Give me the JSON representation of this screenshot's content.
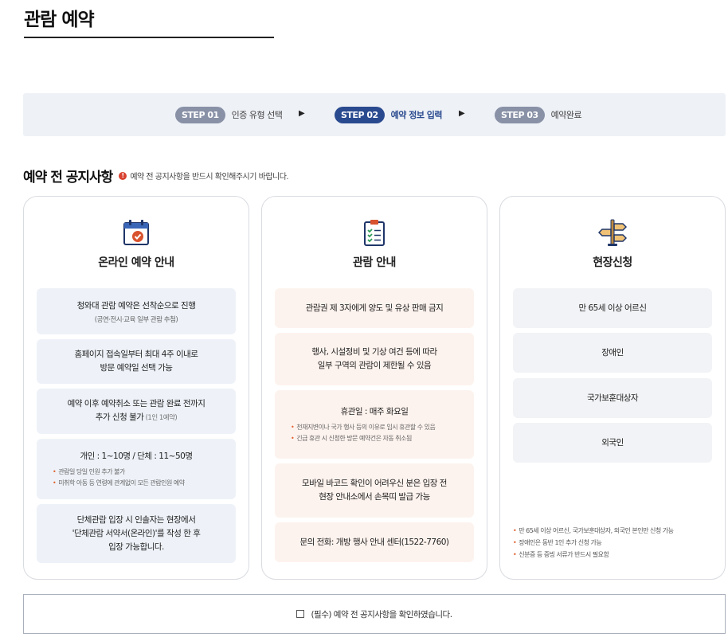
{
  "page": {
    "title": "관람 예약"
  },
  "steps": [
    {
      "badge": "STEP 01",
      "label": "인증 유형 선택",
      "active": false
    },
    {
      "badge": "STEP 02",
      "label": "예약 정보 입력",
      "active": true
    },
    {
      "badge": "STEP 03",
      "label": "예약완료",
      "active": false
    }
  ],
  "step_arrow": "▶",
  "notice": {
    "title": "예약 전 공지사항",
    "alert_glyph": "!",
    "subtitle": "예약 전 공지사항을 반드시 확인해주시기 바랍니다."
  },
  "cards": [
    {
      "title": "온라인 예약 안내",
      "icon": "calendar-check-icon",
      "boxes": [
        {
          "lines": [
            "청와대 관람 예약은 선착순으로 진행"
          ],
          "sub": "(공연·전시·교육 일부 관람 추첨)"
        },
        {
          "lines": [
            "홈페이지 접속일부터 최대 4주 이내로",
            "방문 예약일 선택 가능"
          ]
        },
        {
          "lines": [
            "예약 이후 예약취소 또는 관람 완료 전까지"
          ],
          "line2_main": "추가 신청 불가",
          "line2_muted": " (1인 1예약)"
        },
        {
          "lines": [
            "개인 : 1~10명 / 단체 : 11~50명"
          ],
          "notes": [
            "관람일 당일 인원 추가 불가",
            "미취학 아동 등 연령에 관계없이 모든 관람인원 예약"
          ]
        },
        {
          "lines": [
            "단체관람 입장 시 인솔자는 현장에서",
            "'단체관람 서약서(온라인)'를 작성 한 후",
            "입장 가능합니다."
          ]
        }
      ]
    },
    {
      "title": "관람 안내",
      "icon": "clipboard-checklist-icon",
      "boxes": [
        {
          "lines": [
            "관람권 제 3자에게 양도 및 유상 판매 금지"
          ]
        },
        {
          "lines": [
            "행사, 시설정비 및 기상 여건 등에 따라",
            "일부 구역의 관람이 제한될 수 있음"
          ]
        },
        {
          "lines": [
            "휴관일 : 매주 화요일"
          ],
          "notes": [
            "천재지변이나 국가 행사 등의 이유로 임시 휴관할 수 있음",
            "긴급 휴관 시 신청한 방문 예약건은 자동 취소됨"
          ]
        },
        {
          "lines": [
            "모바일 바코드 확인이 어려우신 분은 입장 전",
            "현장 안내소에서 손목띠 발급 가능"
          ]
        },
        {
          "lines": [
            "문의 전화: 개방 행사 안내 센터(1522-7760)"
          ]
        }
      ]
    },
    {
      "title": "현장신청",
      "icon": "signpost-icon",
      "boxes": [
        {
          "lines": [
            "만 65세 이상 어르신"
          ]
        },
        {
          "lines": [
            "장애인"
          ]
        },
        {
          "lines": [
            "국가보훈대상자"
          ]
        },
        {
          "lines": [
            "외국인"
          ]
        }
      ],
      "footnotes": [
        "만 65세 이상 어르신, 국가보훈대상자, 외국인 본인만 신청 가능",
        "장애인은 동반 1인 추가 신청 가능",
        "신분증 등 증빙 서류가 반드시 필요함"
      ]
    }
  ],
  "agreement": {
    "label": "(필수) 예약 전 공지사항을 확인하였습니다."
  },
  "colors": {
    "accent": "#2a4a8f",
    "step_inactive": "#8891a6",
    "bar_bg": "#eef1f6",
    "bullet": "#e0612f"
  }
}
